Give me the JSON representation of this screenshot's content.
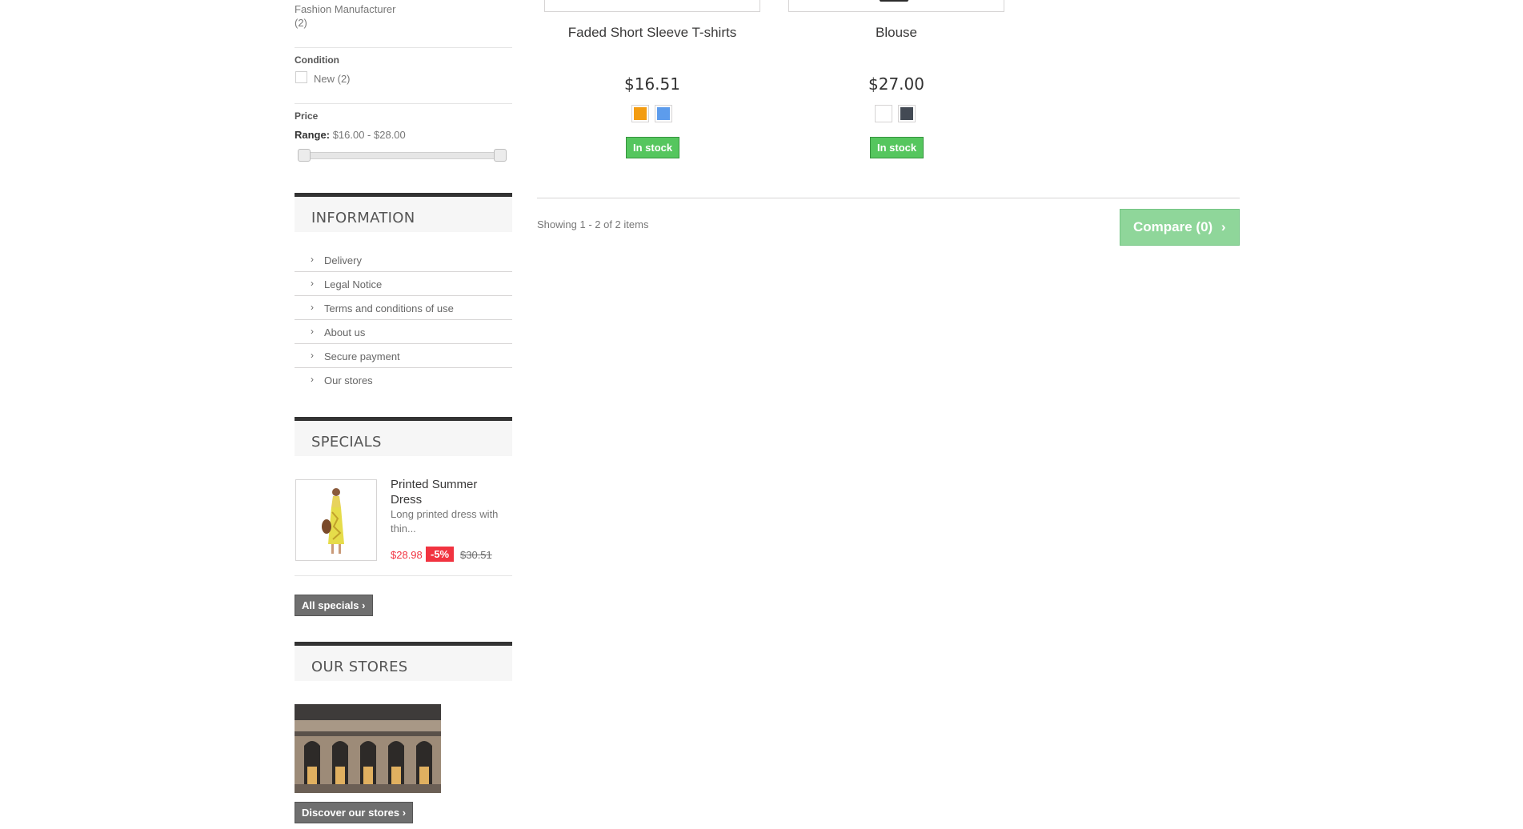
{
  "filters": {
    "manufacturer": {
      "label": "Fashion Manufacturer",
      "count": "(2)"
    },
    "condition": {
      "title": "Condition",
      "option": "New (2)"
    },
    "price": {
      "title": "Price",
      "range_label": "Range:",
      "range_value": "$16.00 - $28.00"
    }
  },
  "information": {
    "title": "INFORMATION",
    "links": [
      "Delivery",
      "Legal Notice",
      "Terms and conditions of use",
      "About us",
      "Secure payment",
      "Our stores"
    ]
  },
  "specials": {
    "title": "SPECIALS",
    "product": {
      "name": "Printed Summer Dress",
      "description": "Long printed dress with thin...",
      "price": "$28.98",
      "discount": "-5%",
      "old_price": "$30.51"
    },
    "all_button": "All specials"
  },
  "stores": {
    "title": "OUR STORES",
    "discover_button": "Discover our stores"
  },
  "products": [
    {
      "name": "Faded Short Sleeve T-shirts",
      "price": "$16.51",
      "swatches": [
        "#f39c11",
        "#5d9cec"
      ],
      "stock": "In stock"
    },
    {
      "name": "Blouse",
      "price": "$27.00",
      "swatches": [
        "#ffffff",
        "#434a54"
      ],
      "stock": "In stock"
    }
  ],
  "listing": {
    "showing": "Showing 1 - 2 of 2 items",
    "compare_label": "Compare (0)"
  },
  "colors": {
    "stock_green": "#55c65e",
    "sale_red": "#f13340",
    "compare_green": "#8fd69a"
  }
}
